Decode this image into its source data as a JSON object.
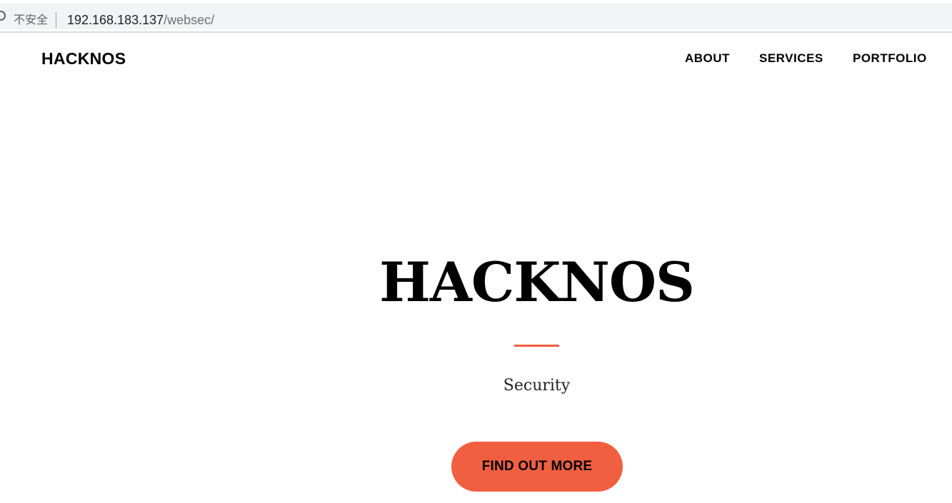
{
  "browser": {
    "security_label": "不安全",
    "url_host": "192.168.183.137",
    "url_path": "/websec/",
    "icon": "info-icon"
  },
  "navbar": {
    "brand": "HACKNOS",
    "links": [
      {
        "label": "ABOUT"
      },
      {
        "label": "SERVICES"
      },
      {
        "label": "PORTFOLIO"
      }
    ]
  },
  "hero": {
    "title": "HACKNOS",
    "subtitle": "Security",
    "cta_label": "FIND OUT MORE"
  },
  "colors": {
    "accent": "#f05f40",
    "background": "#ffffff",
    "text": "#000000"
  }
}
